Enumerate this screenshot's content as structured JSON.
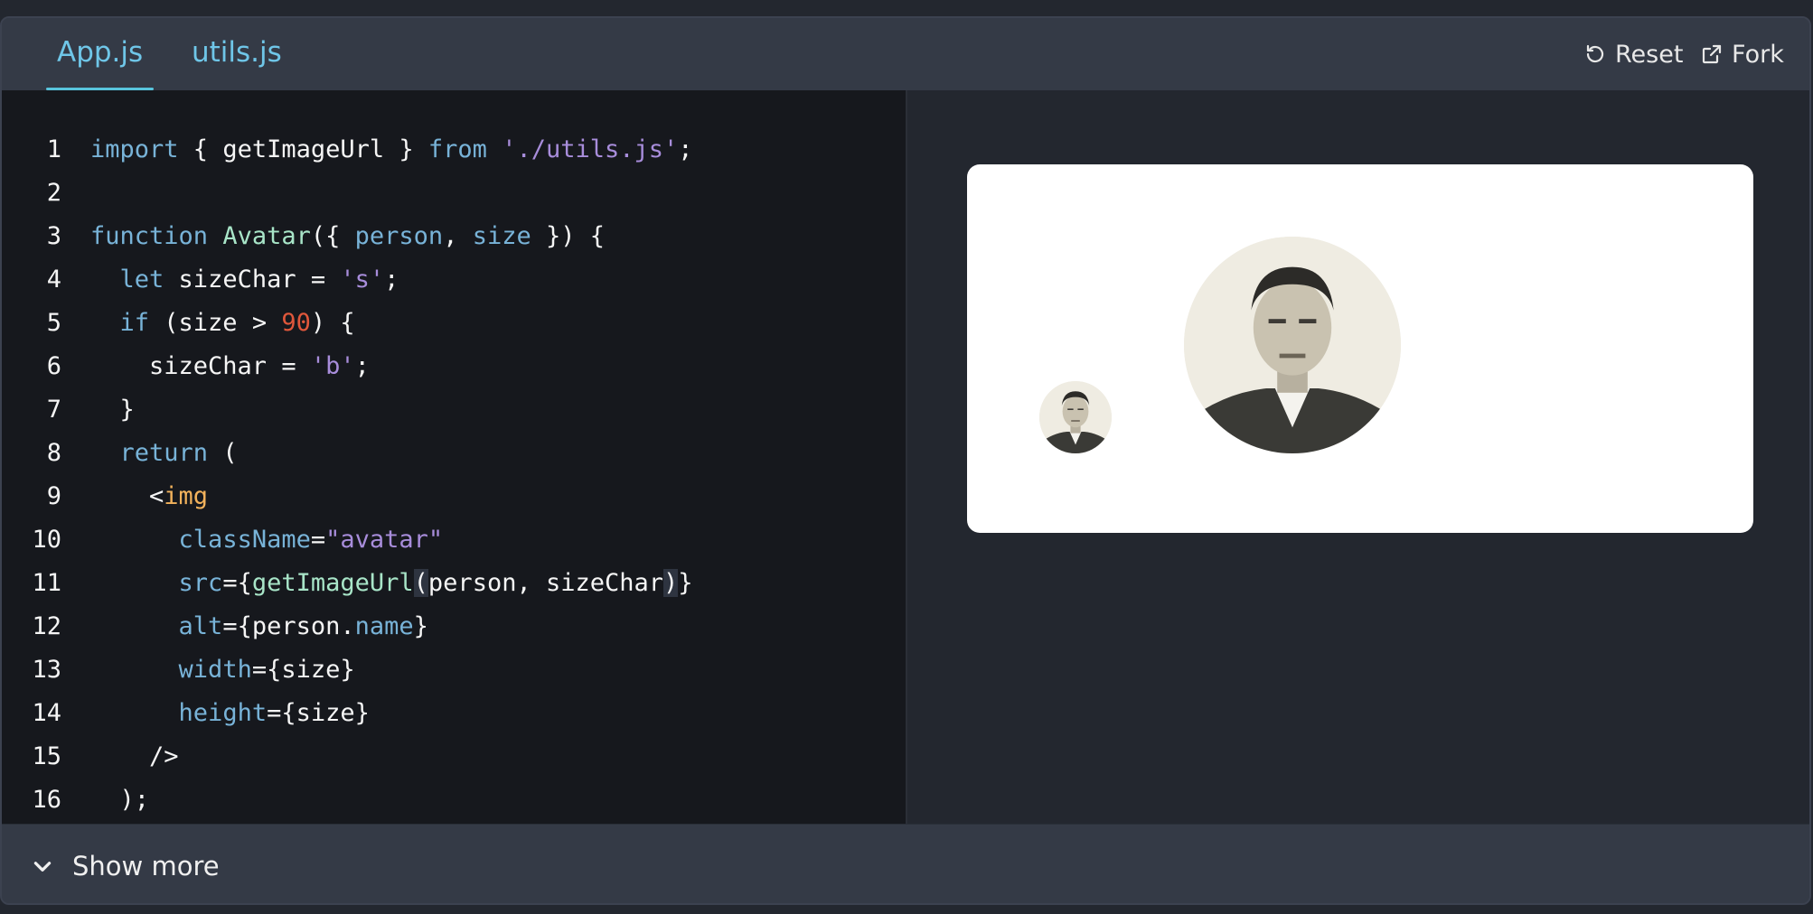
{
  "tabs": [
    {
      "label": "App.js",
      "active": true
    },
    {
      "label": "utils.js",
      "active": false
    }
  ],
  "actions": {
    "reset_label": "Reset",
    "reset_icon": "reset-icon",
    "fork_label": "Fork",
    "fork_icon": "external-link-icon"
  },
  "editor": {
    "line_numbers": [
      "1",
      "2",
      "3",
      "4",
      "5",
      "6",
      "7",
      "8",
      "9",
      "10",
      "11",
      "12",
      "13",
      "14",
      "15",
      "16"
    ]
  },
  "preview": {
    "avatars": [
      {
        "name": "small-avatar"
      },
      {
        "name": "large-avatar"
      }
    ]
  },
  "footer": {
    "show_more_label": "Show more",
    "chevron_icon": "chevron-down-icon"
  },
  "colors": {
    "accent": "#58c4dc",
    "background": "#23272f",
    "editor_bg": "#16181d"
  }
}
